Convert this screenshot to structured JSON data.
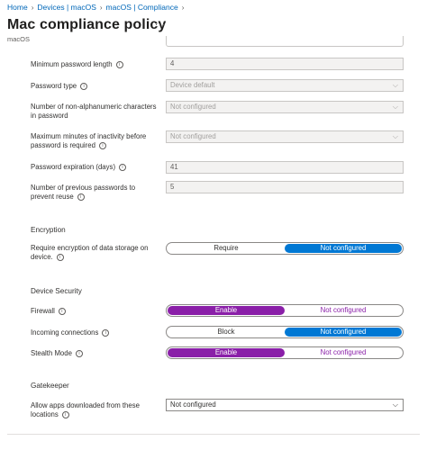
{
  "breadcrumb": [
    {
      "label": "Home"
    },
    {
      "label": "Devices | macOS"
    },
    {
      "label": "macOS | Compliance"
    }
  ],
  "page": {
    "title": "Mac compliance policy",
    "more": "...",
    "subtitle": "macOS"
  },
  "password": {
    "min_length": {
      "label": "Minimum password length",
      "value": "4"
    },
    "type": {
      "label": "Password type",
      "value": "Device default"
    },
    "non_alnum": {
      "label_line1": "Number of non-alphanumeric characters",
      "label_line2": "in password",
      "value": "Not configured"
    },
    "inactivity": {
      "label_line1": "Maximum minutes of inactivity before",
      "label_line2": "password is required",
      "value": "Not configured"
    },
    "expiration": {
      "label": "Password expiration (days)",
      "value": "41"
    },
    "reuse": {
      "label_line1": "Number of previous passwords to",
      "label_line2": "prevent reuse",
      "value": "5"
    }
  },
  "encryption": {
    "section": "Encryption",
    "require": {
      "label_line1": "Require encryption of data storage on",
      "label_line2": "device.",
      "opt_a": "Require",
      "opt_b": "Not configured",
      "selected": "opt_b"
    }
  },
  "device_security": {
    "section": "Device Security",
    "firewall": {
      "label": "Firewall",
      "opt_a": "Enable",
      "opt_b": "Not configured",
      "selected": "opt_a"
    },
    "incoming": {
      "label": "Incoming connections",
      "opt_a": "Block",
      "opt_b": "Not configured",
      "selected": "opt_b"
    },
    "stealth": {
      "label": "Stealth Mode",
      "opt_a": "Enable",
      "opt_b": "Not configured",
      "selected": "opt_a"
    }
  },
  "gatekeeper": {
    "section": "Gatekeeper",
    "allow_apps": {
      "label_line1": "Allow apps downloaded from these",
      "label_line2": "locations",
      "value": "Not configured"
    }
  },
  "icons": {
    "info": "i",
    "chevron_right": "›",
    "chevron_down": "⌵"
  },
  "colors": {
    "link": "#0067b8",
    "toggle_blue": "#0078d4",
    "toggle_purple": "#8a1fa8"
  }
}
